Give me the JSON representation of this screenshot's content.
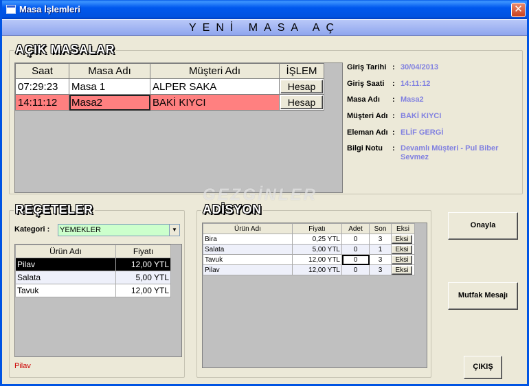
{
  "window": {
    "title": "Masa İşlemleri",
    "close_glyph": "✕"
  },
  "header": {
    "title": "YENİ MASA AÇ"
  },
  "acik_masalar": {
    "title": "AÇIK MASALAR",
    "columns": [
      "Saat",
      "Masa Adı",
      "Müşteri Adı",
      "İŞLEM"
    ],
    "rows": [
      {
        "saat": "07:29:23",
        "masa": "Masa 1",
        "musteri": "ALPER SAKA",
        "islem": "Hesap"
      },
      {
        "saat": "14:11:12",
        "masa": "Masa2",
        "musteri": "BAKİ KIYCI",
        "islem": "Hesap"
      }
    ]
  },
  "info": {
    "giris_tarihi": {
      "label": "Giriş Tarihi",
      "value": "30/04/2013"
    },
    "giris_saati": {
      "label": "Giriş Saati",
      "value": "14:11:12"
    },
    "masa_adi": {
      "label": "Masa Adı",
      "value": "Masa2"
    },
    "musteri_adi": {
      "label": "Müşteri Adı",
      "value": "BAKİ KIYCI"
    },
    "eleman_adi": {
      "label": "Eleman Adı",
      "value": "ELİF GERGİ"
    },
    "bilgi_notu": {
      "label": "Bilgi Notu",
      "value": "Devamlı Müşteri - Pul Biber Sevmez"
    },
    "separator": ":"
  },
  "receteler": {
    "title": "REÇETELER",
    "kategori_label": "Kategori :",
    "kategori_value": "YEMEKLER",
    "columns": [
      "Ürün Adı",
      "Fiyatı"
    ],
    "rows": [
      {
        "urun": "Pilav",
        "fiyat": "12,00 YTL"
      },
      {
        "urun": "Salata",
        "fiyat": "5,00 YTL"
      },
      {
        "urun": "Tavuk",
        "fiyat": "12,00 YTL"
      }
    ],
    "status_text": "Pilav"
  },
  "adisyon": {
    "title": "ADİSYON",
    "columns": [
      "Ürün Adı",
      "Fiyatı",
      "Adet",
      "Son",
      "Eksi"
    ],
    "rows": [
      {
        "urun": "Bira",
        "fiyat": "0,25 YTL",
        "adet": "0",
        "son": "3",
        "eksi": "Eksi"
      },
      {
        "urun": "Salata",
        "fiyat": "5,00 YTL",
        "adet": "0",
        "son": "1",
        "eksi": "Eksi"
      },
      {
        "urun": "Tavuk",
        "fiyat": "12,00 YTL",
        "adet": "0",
        "son": "3",
        "eksi": "Eksi"
      },
      {
        "urun": "Pilav",
        "fiyat": "12,00 YTL",
        "adet": "0",
        "son": "3",
        "eksi": "Eksi"
      }
    ]
  },
  "buttons": {
    "onayla": "Onayla",
    "mutfak": "Mutfak Mesajı",
    "cikis": "ÇIKIŞ"
  },
  "watermark": "GEZGİNLER",
  "colors": {
    "selected_row": "#ff8080",
    "info_value": "#8080e0",
    "combo_bg": "#ccffcc",
    "status_text": "#cc0000"
  }
}
